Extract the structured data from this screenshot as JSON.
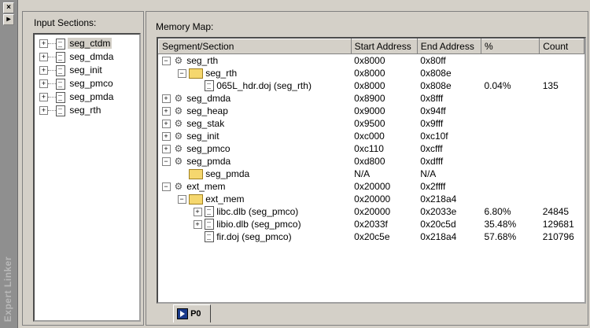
{
  "sidebar": {
    "title": "Expert Linker",
    "close_glyph": "×",
    "pin_glyph": "▸"
  },
  "input_sections": {
    "label": "Input Sections:",
    "items": [
      "seg_ctdm",
      "seg_dmda",
      "seg_init",
      "seg_pmco",
      "seg_pmda",
      "seg_rth"
    ]
  },
  "memory_map": {
    "label": "Memory Map:",
    "columns": [
      "Segment/Section",
      "Start Address",
      "End Address",
      "%",
      "Count"
    ],
    "rows": [
      {
        "name": "seg_rth",
        "start": "0x8000",
        "end": "0x80ff",
        "pct": "",
        "count": ""
      },
      {
        "name": "seg_rth",
        "start": "0x8000",
        "end": "0x808e",
        "pct": "",
        "count": ""
      },
      {
        "name": "065L_hdr.doj (seg_rth)",
        "start": "0x8000",
        "end": "0x808e",
        "pct": "0.04%",
        "count": "135"
      },
      {
        "name": "seg_dmda",
        "start": "0x8900",
        "end": "0x8fff",
        "pct": "",
        "count": ""
      },
      {
        "name": "seg_heap",
        "start": "0x9000",
        "end": "0x94ff",
        "pct": "",
        "count": ""
      },
      {
        "name": "seg_stak",
        "start": "0x9500",
        "end": "0x9fff",
        "pct": "",
        "count": ""
      },
      {
        "name": "seg_init",
        "start": "0xc000",
        "end": "0xc10f",
        "pct": "",
        "count": ""
      },
      {
        "name": "seg_pmco",
        "start": "0xc110",
        "end": "0xcfff",
        "pct": "",
        "count": ""
      },
      {
        "name": "seg_pmda",
        "start": "0xd800",
        "end": "0xdfff",
        "pct": "",
        "count": ""
      },
      {
        "name": "seg_pmda",
        "start": "N/A",
        "end": "N/A",
        "pct": "",
        "count": ""
      },
      {
        "name": "ext_mem",
        "start": "0x20000",
        "end": "0x2ffff",
        "pct": "",
        "count": ""
      },
      {
        "name": "ext_mem",
        "start": "0x20000",
        "end": "0x218a4",
        "pct": "",
        "count": ""
      },
      {
        "name": "libc.dlb (seg_pmco)",
        "start": "0x20000",
        "end": "0x2033e",
        "pct": "6.80%",
        "count": "24845"
      },
      {
        "name": "libio.dlb (seg_pmco)",
        "start": "0x2033f",
        "end": "0x20c5d",
        "pct": "35.48%",
        "count": "129681"
      },
      {
        "name": "fir.doj (seg_pmco)",
        "start": "0x20c5e",
        "end": "0x218a4",
        "pct": "57.68%",
        "count": "210796"
      }
    ]
  },
  "tab": {
    "label": "P0"
  }
}
